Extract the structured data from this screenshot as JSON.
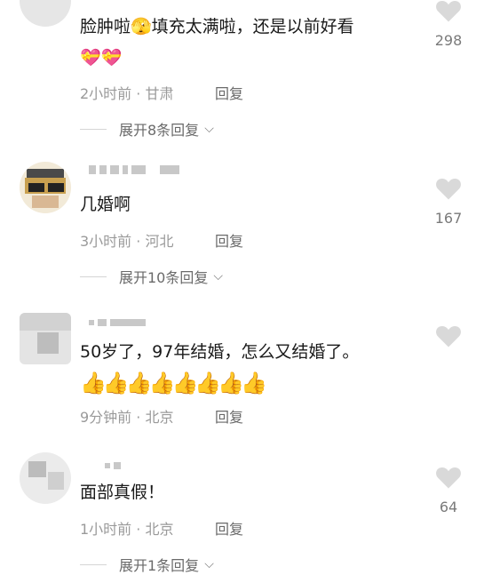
{
  "comments": [
    {
      "text": "脸肿啦🫣填充太满啦，还是以前好看",
      "emojis": "💝💝",
      "time": "2小时前",
      "location": "甘肃",
      "reply_label": "回复",
      "expand_label": "展开8条回复",
      "likes": "298"
    },
    {
      "text": "几婚啊",
      "time": "3小时前",
      "location": "河北",
      "reply_label": "回复",
      "expand_label": "展开10条回复",
      "likes": "167"
    },
    {
      "text": "50岁了，97年结婚，怎么又结婚了。",
      "emojis": "👍👍👍👍👍👍👍👍",
      "time": "9分钟前",
      "location": "北京",
      "reply_label": "回复",
      "likes": ""
    },
    {
      "text": "面部真假！",
      "time": "1小时前",
      "location": "北京",
      "reply_label": "回复",
      "expand_label": "展开1条回复",
      "likes": "64"
    }
  ],
  "meta_separator": " · ",
  "icons": {
    "like": "heart-icon",
    "expand": "chevron-down-icon"
  },
  "colors": {
    "text": "#1a1a1a",
    "meta": "#9a9a9a",
    "heart": "#d9d9d9"
  }
}
